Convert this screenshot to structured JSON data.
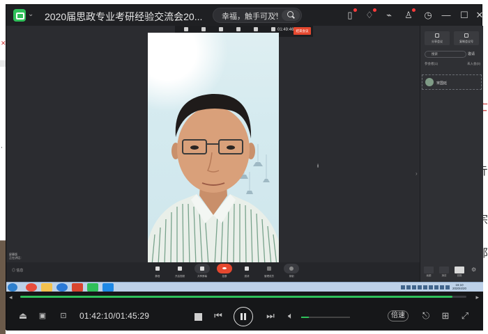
{
  "window": {
    "title": "2020届思政专业考研经验交流会20...",
    "search_text": "幸福，触手可及！",
    "search_clear": "×"
  },
  "titlebar_icons": [
    {
      "name": "clipboard-icon",
      "glyph": "▯",
      "badge": true
    },
    {
      "name": "bell-icon",
      "glyph": "♢",
      "badge": true
    },
    {
      "name": "share-icon",
      "glyph": "⌁",
      "badge": false
    },
    {
      "name": "skin-icon",
      "glyph": "♙",
      "badge": true
    },
    {
      "name": "history-icon",
      "glyph": "◷",
      "badge": false
    },
    {
      "name": "minimize-icon",
      "glyph": "—",
      "badge": false
    },
    {
      "name": "maximize-icon",
      "glyph": "☐",
      "badge": false
    },
    {
      "name": "close-icon",
      "glyph": "✕",
      "badge": false
    }
  ],
  "meeting": {
    "toolbar_items": [
      "静音",
      "全体视频开启",
      "开始屏幕",
      "管理参会者",
      "邀请参会成员",
      "结束共享"
    ],
    "timer": "01:49:46",
    "end_label": "结束会议",
    "speaker_label": "屏幕版\n正在讲话：",
    "bottom_left_label": "◎ 信息",
    "controls": [
      "静音",
      "开启视频",
      "共享屏幕",
      "挂断",
      "邀请",
      "管理成员",
      "录制"
    ],
    "layout_labels": [
      "画廊",
      "演讲",
      "宫格"
    ]
  },
  "side_panel": {
    "btn_left": "分享会议",
    "btn_right": "复制会议号",
    "search_placeholder": "搜索",
    "invite": "邀请",
    "tab_left": "参会者(1)",
    "tab_right": "未入会(0)",
    "member_name": "宋国廷"
  },
  "taskbar": {
    "clock": "16:10\n2020/4/20"
  },
  "playback": {
    "time": "01:42:10/01:45:29",
    "progress": 0.968,
    "volume": 0.15,
    "speed_label": "倍速"
  },
  "colors": {
    "accent": "#2fc05a",
    "end_red": "#e5482f"
  }
}
